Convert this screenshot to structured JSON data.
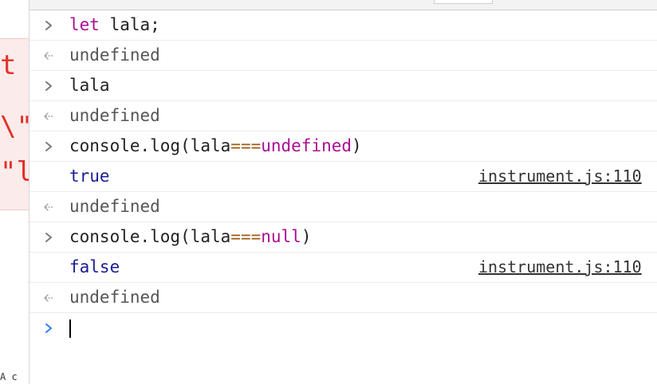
{
  "left_pane": {
    "fragments": [
      "t",
      "\\\"",
      "\"l"
    ],
    "bottom_text": "A c"
  },
  "console": {
    "entries": [
      {
        "kind": "input",
        "parts": [
          {
            "t": "let",
            "c": "kw"
          },
          {
            "t": " lala;",
            "c": "input"
          }
        ]
      },
      {
        "kind": "return",
        "parts": [
          {
            "t": "undefined",
            "c": "out"
          }
        ]
      },
      {
        "kind": "input",
        "parts": [
          {
            "t": "lala",
            "c": "input"
          }
        ]
      },
      {
        "kind": "return",
        "parts": [
          {
            "t": "undefined",
            "c": "out"
          }
        ]
      },
      {
        "kind": "input",
        "parts": [
          {
            "t": "console.log(lala",
            "c": "input"
          },
          {
            "t": "===",
            "c": "op"
          },
          {
            "t": "undefined",
            "c": "kw"
          },
          {
            "t": ")",
            "c": "input"
          }
        ]
      },
      {
        "kind": "log",
        "parts": [
          {
            "t": "true",
            "c": "val"
          }
        ],
        "source": "instrument.js:110"
      },
      {
        "kind": "return",
        "parts": [
          {
            "t": "undefined",
            "c": "out"
          }
        ]
      },
      {
        "kind": "input",
        "parts": [
          {
            "t": "console.log(lala",
            "c": "input"
          },
          {
            "t": "===",
            "c": "op"
          },
          {
            "t": "null",
            "c": "kw"
          },
          {
            "t": ")",
            "c": "input"
          }
        ]
      },
      {
        "kind": "log",
        "parts": [
          {
            "t": "false",
            "c": "val"
          }
        ],
        "source": "instrument.js:110"
      },
      {
        "kind": "return",
        "parts": [
          {
            "t": "undefined",
            "c": "out"
          }
        ]
      }
    ],
    "prompt": {
      "value": ""
    }
  },
  "icons": {
    "input": "chevron-right-icon",
    "return": "return-arrow-icon",
    "prompt": "prompt-chevron-icon"
  },
  "colors": {
    "keyword": "#aa0d91",
    "operator": "#9c5a0f",
    "value": "#1c1c94",
    "prompt_accent": "#2d7ff9",
    "error_code": "#e3302a"
  }
}
